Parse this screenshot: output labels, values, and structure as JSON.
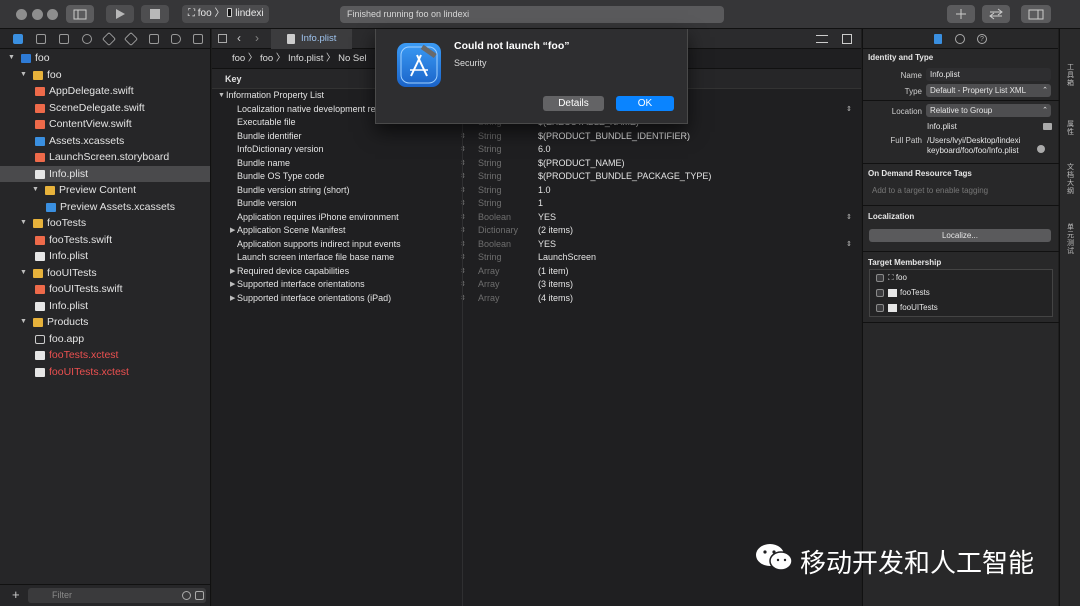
{
  "toolbar": {
    "scheme": "foo",
    "device": "lindexi",
    "status": "Finished running foo on lindexi"
  },
  "navigator": {
    "filter_placeholder": "Filter",
    "items": [
      {
        "label": "foo",
        "kind": "project",
        "level": 0
      },
      {
        "label": "foo",
        "kind": "folder",
        "level": 1
      },
      {
        "label": "AppDelegate.swift",
        "kind": "swift",
        "level": 2
      },
      {
        "label": "SceneDelegate.swift",
        "kind": "swift",
        "level": 2
      },
      {
        "label": "ContentView.swift",
        "kind": "swift",
        "level": 2
      },
      {
        "label": "Assets.xcassets",
        "kind": "blue",
        "level": 2
      },
      {
        "label": "LaunchScreen.storyboard",
        "kind": "swift",
        "level": 2
      },
      {
        "label": "Info.plist",
        "kind": "white",
        "level": 2
      },
      {
        "label": "Preview Content",
        "kind": "folder",
        "level": 2
      },
      {
        "label": "Preview Assets.xcassets",
        "kind": "blue",
        "level": 3
      },
      {
        "label": "fooTests",
        "kind": "folder",
        "level": 1
      },
      {
        "label": "fooTests.swift",
        "kind": "swift",
        "level": 2
      },
      {
        "label": "Info.plist",
        "kind": "white",
        "level": 2
      },
      {
        "label": "fooUITests",
        "kind": "folder",
        "level": 1
      },
      {
        "label": "fooUITests.swift",
        "kind": "swift",
        "level": 2
      },
      {
        "label": "Info.plist",
        "kind": "white",
        "level": 2
      },
      {
        "label": "Products",
        "kind": "folder",
        "level": 1
      },
      {
        "label": "foo.app",
        "kind": "app",
        "level": 2
      },
      {
        "label": "fooTests.xctest",
        "kind": "product-missing",
        "level": 2
      },
      {
        "label": "fooUITests.xctest",
        "kind": "product-missing",
        "level": 2
      }
    ]
  },
  "editor": {
    "tab": "Info.plist",
    "jump_bar": "foo 〉 foo 〉 Info.plist 〉 No Sel",
    "key_header": "Key",
    "rows": [
      {
        "key": "Information Property List",
        "type": "",
        "value": "",
        "expand": "down"
      },
      {
        "key": "Localization native development re",
        "type": "",
        "value": "",
        "expand": ""
      },
      {
        "key": "Executable file",
        "type": "String",
        "value": "$(EXECUTABLE_NAME)",
        "expand": ""
      },
      {
        "key": "Bundle identifier",
        "type": "String",
        "value": "$(PRODUCT_BUNDLE_IDENTIFIER)",
        "expand": ""
      },
      {
        "key": "InfoDictionary version",
        "type": "String",
        "value": "6.0",
        "expand": ""
      },
      {
        "key": "Bundle name",
        "type": "String",
        "value": "$(PRODUCT_NAME)",
        "expand": ""
      },
      {
        "key": "Bundle OS Type code",
        "type": "String",
        "value": "$(PRODUCT_BUNDLE_PACKAGE_TYPE)",
        "expand": ""
      },
      {
        "key": "Bundle version string (short)",
        "type": "String",
        "value": "1.0",
        "expand": ""
      },
      {
        "key": "Bundle version",
        "type": "String",
        "value": "1",
        "expand": ""
      },
      {
        "key": "Application requires iPhone environment",
        "type": "Boolean",
        "value": "YES",
        "expand": ""
      },
      {
        "key": "Application Scene Manifest",
        "type": "Dictionary",
        "value": "(2 items)",
        "expand": "right"
      },
      {
        "key": "Application supports indirect input events",
        "type": "Boolean",
        "value": "YES",
        "expand": ""
      },
      {
        "key": "Launch screen interface file base name",
        "type": "String",
        "value": "LaunchScreen",
        "expand": ""
      },
      {
        "key": "Required device capabilities",
        "type": "Array",
        "value": "(1 item)",
        "expand": "right"
      },
      {
        "key": "Supported interface orientations",
        "type": "Array",
        "value": "(3 items)",
        "expand": "right"
      },
      {
        "key": "Supported interface orientations (iPad)",
        "type": "Array",
        "value": "(4 items)",
        "expand": "right"
      }
    ]
  },
  "dialog": {
    "title": "Could not launch “foo”",
    "message": "Security",
    "details_label": "Details",
    "ok_label": "OK"
  },
  "inspector": {
    "identity_title": "Identity and Type",
    "name_label": "Name",
    "name_value": "Info.plist",
    "type_label": "Type",
    "type_value": "Default - Property List XML",
    "location_label": "Location",
    "location_value": "Relative to Group",
    "location_file": "Info.plist",
    "fullpath_label": "Full Path",
    "fullpath_value": "/Users/lvyi/Desktop/lindexi keyboard/foo/foo/Info.plist",
    "odr_title": "On Demand Resource Tags",
    "odr_placeholder": "Add to a target to enable tagging",
    "localization_title": "Localization",
    "localize_button": "Localize...",
    "target_title": "Target Membership",
    "targets": [
      "foo",
      "fooTests",
      "fooUITests"
    ]
  },
  "side_strip": [
    "工具箱",
    "属性",
    "文档大纲",
    "单元测试"
  ],
  "watermark": "移动开发和人工智能",
  "colors": {
    "accent": "#0a84ff",
    "missing_product": "#ec5050",
    "folder": "#e7b23b"
  }
}
